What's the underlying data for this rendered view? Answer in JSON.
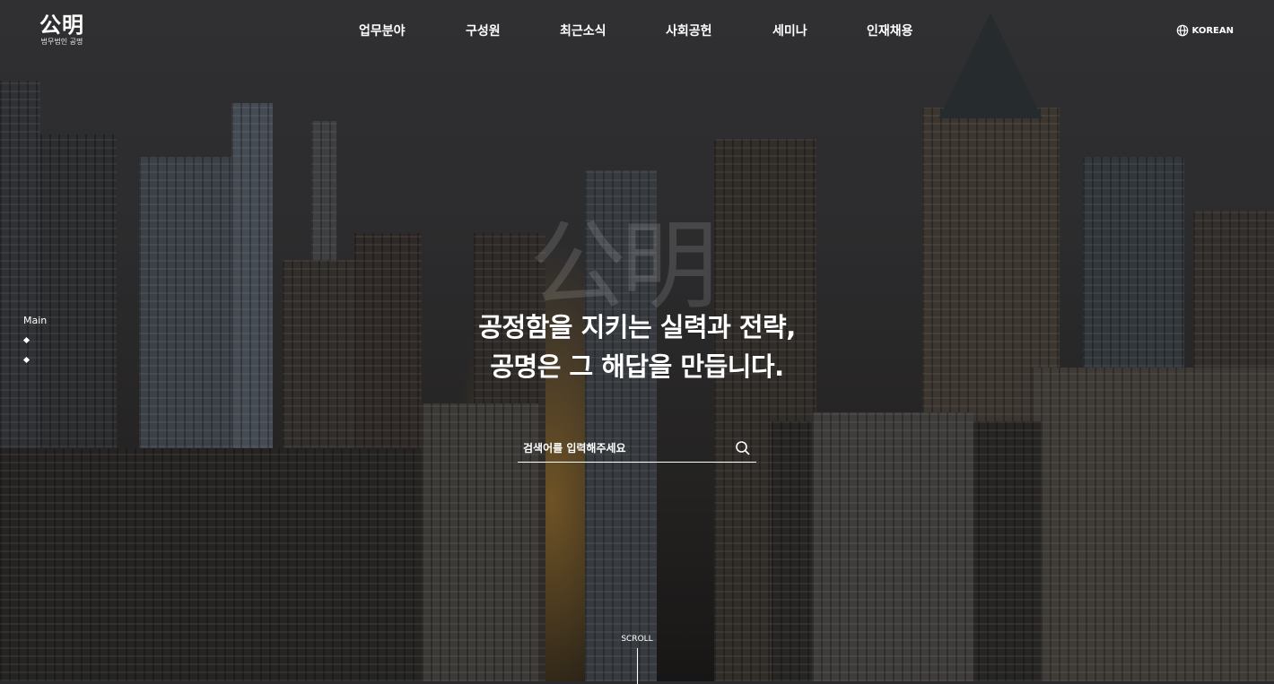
{
  "header": {
    "logo_mark": "公明",
    "logo_sub": "법무법인 공명",
    "nav": [
      "업무분야",
      "구성원",
      "최근소식",
      "사회공헌",
      "세미나",
      "인재채용"
    ],
    "language": "KOREAN",
    "language_icon": "globe-icon"
  },
  "hero": {
    "watermark": "公明",
    "headline_line1": "공정함을 지키는 실력과 전략,",
    "headline_line2": "공명은 그 해답을 만듭니다.",
    "search_placeholder": "검색어를 입력해주세요",
    "search_icon": "search-icon"
  },
  "side_nav": {
    "label": "Main"
  },
  "scroll": {
    "label": "SCROLL"
  },
  "colors": {
    "text": "#ffffff",
    "overlay": "#2a2a2c",
    "sun_glow": "#d29632"
  }
}
